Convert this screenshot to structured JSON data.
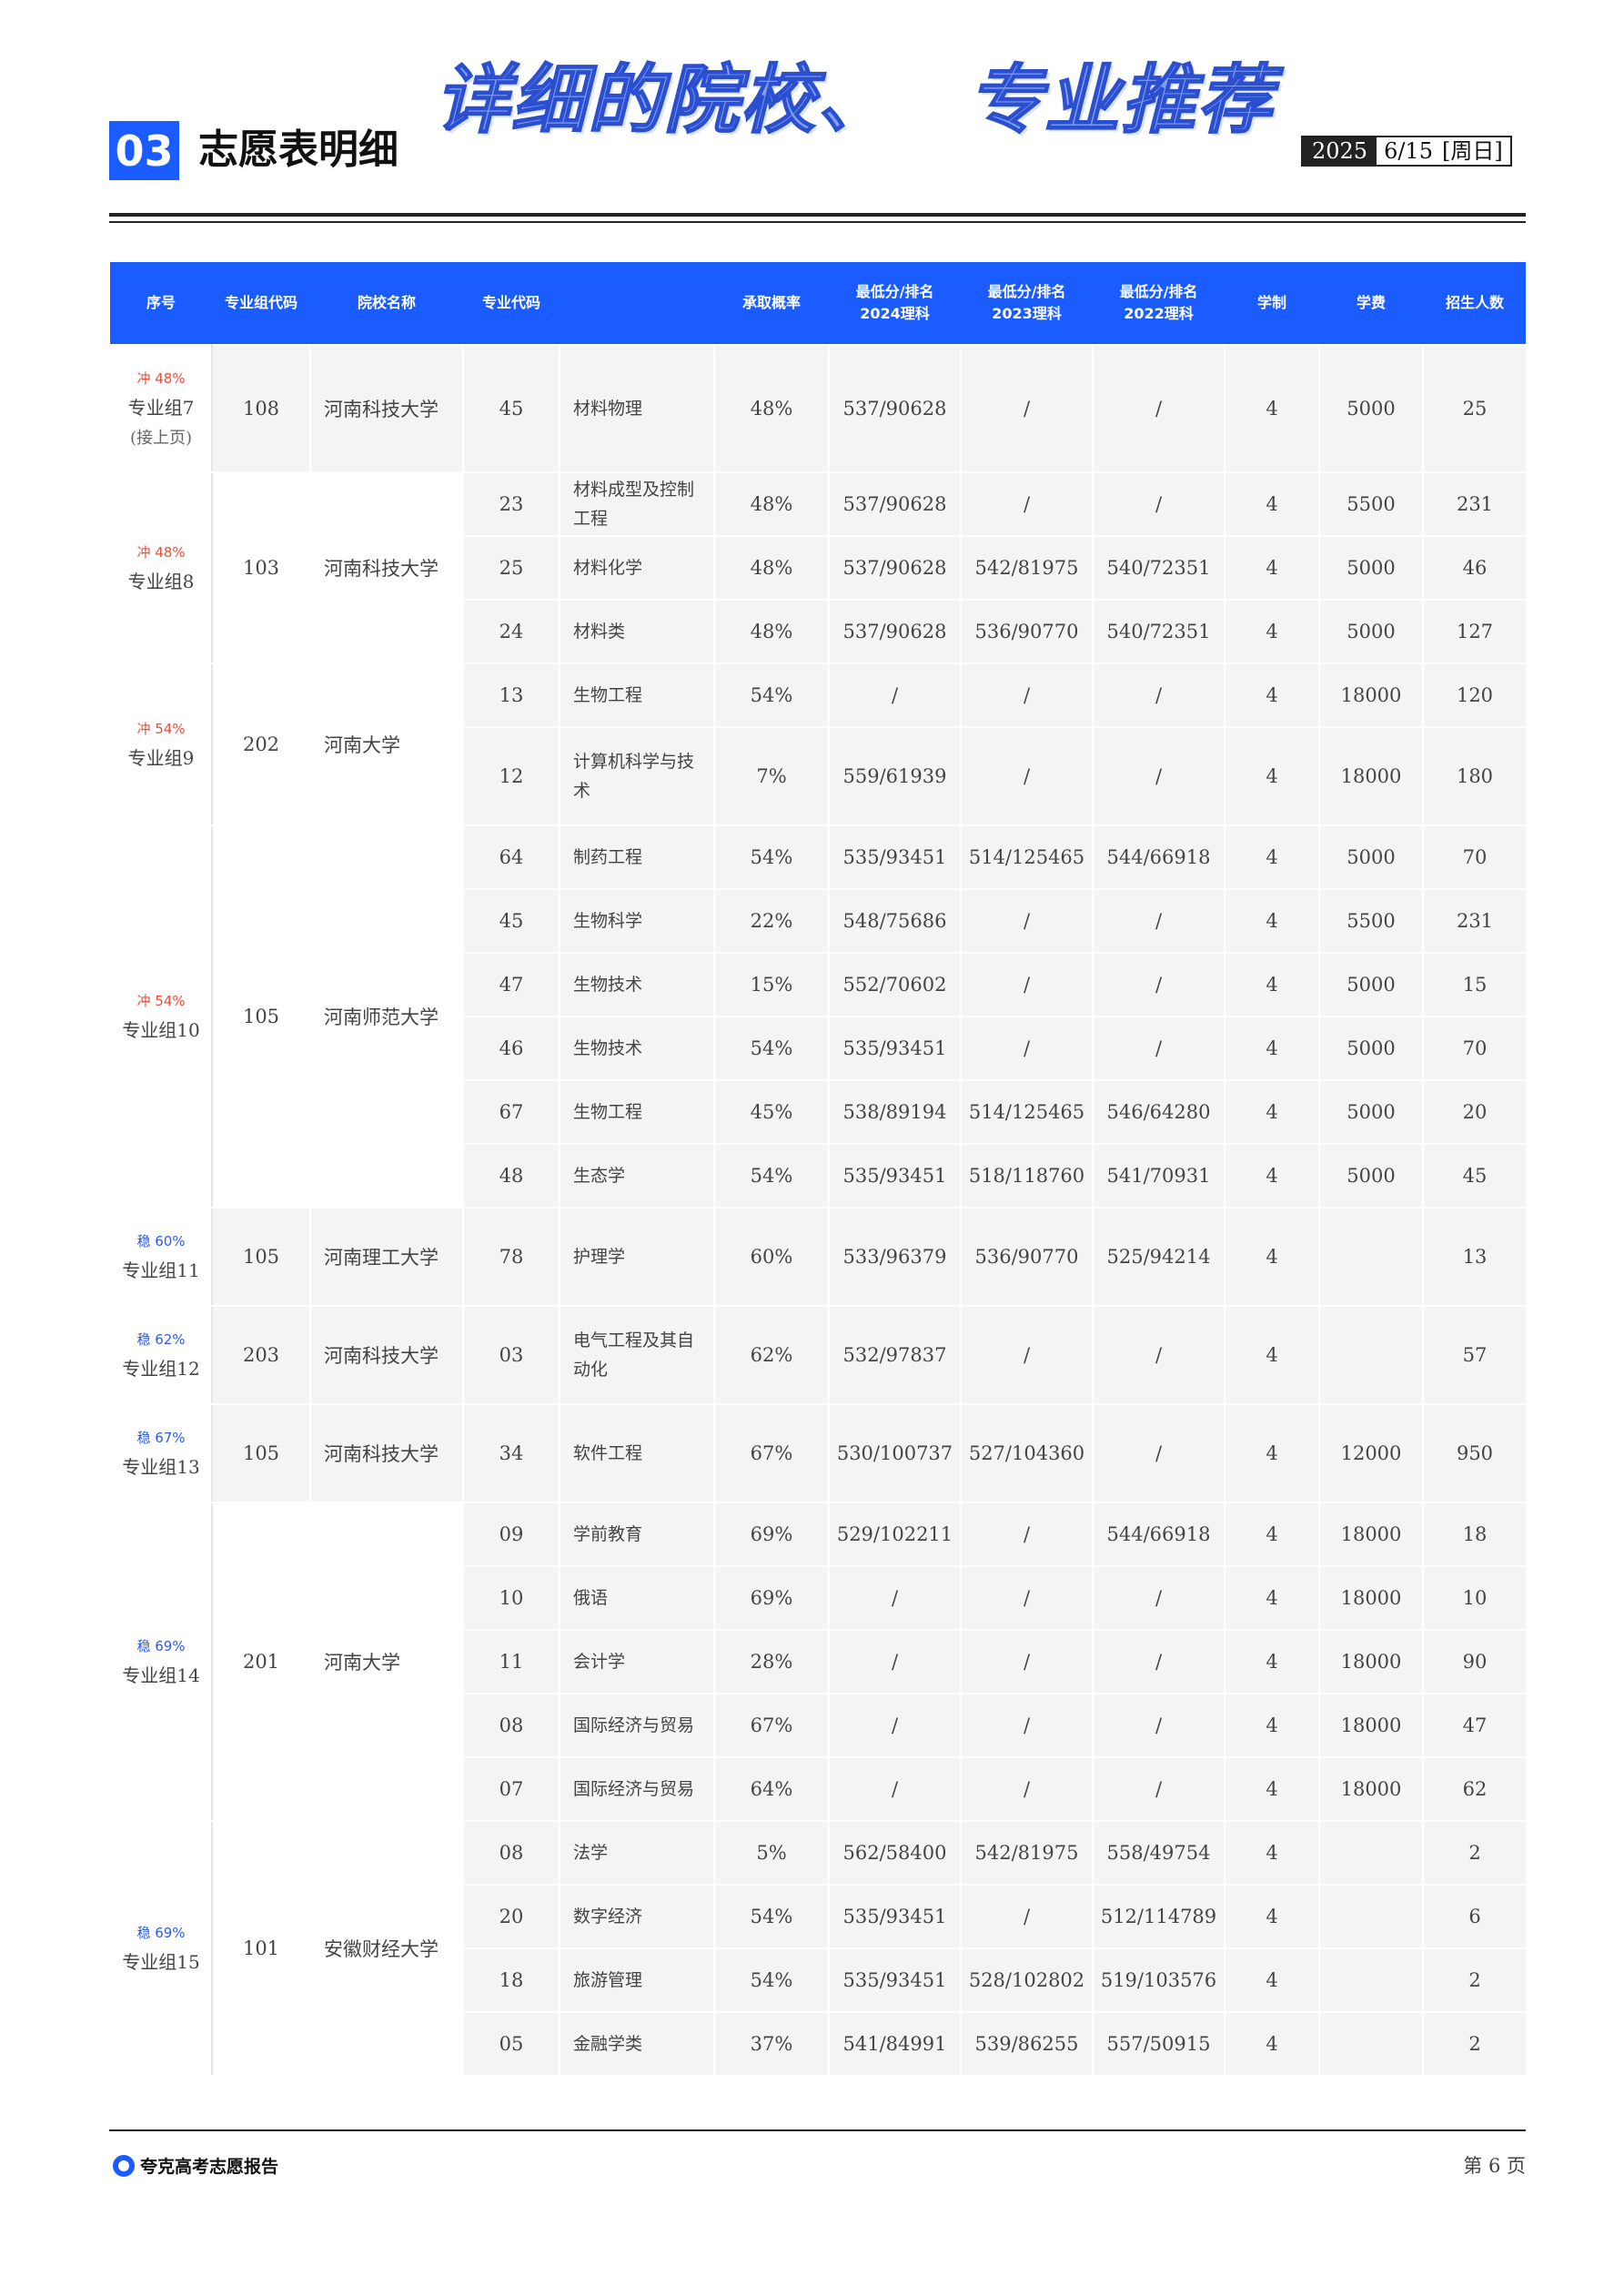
{
  "header": {
    "banner_left": "详细的院校、",
    "banner_right": "专业推荐",
    "section_number": "03",
    "section_title": "志愿表明细",
    "date_year": "2025",
    "date_day": "6/15",
    "date_weekday": "[周日]"
  },
  "table": {
    "headers": {
      "seq": "序号",
      "group_code": "专业组代码",
      "school": "院校名称",
      "major_code": "专业代码",
      "major": "",
      "prob": "承取概率",
      "s2024_line1": "最低分/排名",
      "s2024_line2": "2024理科",
      "s2023_line1": "最低分/排名",
      "s2023_line2": "2023理科",
      "s2022_line1": "最低分/排名",
      "s2022_line2": "2022理科",
      "years": "学制",
      "fee": "学费",
      "quota": "招生人数"
    },
    "groups": [
      {
        "tag": "冲 48%",
        "tag_color": "red",
        "group": "专业组7",
        "note": "(接上页)",
        "code": "108",
        "school": "河南科技大学",
        "rows": [
          {
            "code": "45",
            "major": "材料物理",
            "prob": "48%",
            "s2024": "537/90628",
            "s2023": "/",
            "s2022": "/",
            "years": "4",
            "fee": "5000",
            "quota": "25"
          }
        ]
      },
      {
        "tag": "冲 48%",
        "tag_color": "red",
        "group": "专业组8",
        "note": "",
        "code": "103",
        "school": "河南科技大学",
        "rows": [
          {
            "code": "23",
            "major": "材料成型及控制工程",
            "prob": "48%",
            "s2024": "537/90628",
            "s2023": "/",
            "s2022": "/",
            "years": "4",
            "fee": "5500",
            "quota": "231"
          },
          {
            "code": "25",
            "major": "材料化学",
            "prob": "48%",
            "s2024": "537/90628",
            "s2023": "542/81975",
            "s2022": "540/72351",
            "years": "4",
            "fee": "5000",
            "quota": "46"
          },
          {
            "code": "24",
            "major": "材料类",
            "prob": "48%",
            "s2024": "537/90628",
            "s2023": "536/90770",
            "s2022": "540/72351",
            "years": "4",
            "fee": "5000",
            "quota": "127"
          }
        ]
      },
      {
        "tag": "冲 54%",
        "tag_color": "red",
        "group": "专业组9",
        "note": "",
        "code": "202",
        "school": "河南大学",
        "rows": [
          {
            "code": "13",
            "major": "生物工程",
            "prob": "54%",
            "s2024": "/",
            "s2023": "/",
            "s2022": "/",
            "years": "4",
            "fee": "18000",
            "quota": "120"
          },
          {
            "code": "12",
            "major": "计算机科学与技术",
            "prob": "7%",
            "s2024": "559/61939",
            "s2023": "/",
            "s2022": "/",
            "years": "4",
            "fee": "18000",
            "quota": "180"
          }
        ]
      },
      {
        "tag": "冲 54%",
        "tag_color": "red",
        "group": "专业组10",
        "note": "",
        "code": "105",
        "school": "河南师范大学",
        "rows": [
          {
            "code": "64",
            "major": "制药工程",
            "prob": "54%",
            "s2024": "535/93451",
            "s2023": "514/125465",
            "s2022": "544/66918",
            "years": "4",
            "fee": "5000",
            "quota": "70"
          },
          {
            "code": "45",
            "major": "生物科学",
            "prob": "22%",
            "s2024": "548/75686",
            "s2023": "/",
            "s2022": "/",
            "years": "4",
            "fee": "5500",
            "quota": "231"
          },
          {
            "code": "47",
            "major": "生物技术",
            "prob": "15%",
            "s2024": "552/70602",
            "s2023": "/",
            "s2022": "/",
            "years": "4",
            "fee": "5000",
            "quota": "15"
          },
          {
            "code": "46",
            "major": "生物技术",
            "prob": "54%",
            "s2024": "535/93451",
            "s2023": "/",
            "s2022": "/",
            "years": "4",
            "fee": "5000",
            "quota": "70"
          },
          {
            "code": "67",
            "major": "生物工程",
            "prob": "45%",
            "s2024": "538/89194",
            "s2023": "514/125465",
            "s2022": "546/64280",
            "years": "4",
            "fee": "5000",
            "quota": "20"
          },
          {
            "code": "48",
            "major": "生态学",
            "prob": "54%",
            "s2024": "535/93451",
            "s2023": "518/118760",
            "s2022": "541/70931",
            "years": "4",
            "fee": "5000",
            "quota": "45"
          }
        ]
      },
      {
        "tag": "稳 60%",
        "tag_color": "blue",
        "group": "专业组11",
        "note": "",
        "code": "105",
        "school": "河南理工大学",
        "rows": [
          {
            "code": "78",
            "major": "护理学",
            "prob": "60%",
            "s2024": "533/96379",
            "s2023": "536/90770",
            "s2022": "525/94214",
            "years": "4",
            "fee": "",
            "quota": "13"
          }
        ]
      },
      {
        "tag": "稳 62%",
        "tag_color": "blue",
        "group": "专业组12",
        "note": "",
        "code": "203",
        "school": "河南科技大学",
        "rows": [
          {
            "code": "03",
            "major": "电气工程及其自动化",
            "prob": "62%",
            "s2024": "532/97837",
            "s2023": "/",
            "s2022": "/",
            "years": "4",
            "fee": "",
            "quota": "57"
          }
        ]
      },
      {
        "tag": "稳 67%",
        "tag_color": "blue",
        "group": "专业组13",
        "note": "",
        "code": "105",
        "school": "河南科技大学",
        "rows": [
          {
            "code": "34",
            "major": "软件工程",
            "prob": "67%",
            "s2024": "530/100737",
            "s2023": "527/104360",
            "s2022": "/",
            "years": "4",
            "fee": "12000",
            "quota": "950"
          }
        ]
      },
      {
        "tag": "稳 69%",
        "tag_color": "blue",
        "group": "专业组14",
        "note": "",
        "code": "201",
        "school": "河南大学",
        "rows": [
          {
            "code": "09",
            "major": "学前教育",
            "prob": "69%",
            "s2024": "529/102211",
            "s2023": "/",
            "s2022": "544/66918",
            "years": "4",
            "fee": "18000",
            "quota": "18"
          },
          {
            "code": "10",
            "major": "俄语",
            "prob": "69%",
            "s2024": "/",
            "s2023": "/",
            "s2022": "/",
            "years": "4",
            "fee": "18000",
            "quota": "10"
          },
          {
            "code": "11",
            "major": "会计学",
            "prob": "28%",
            "s2024": "/",
            "s2023": "/",
            "s2022": "/",
            "years": "4",
            "fee": "18000",
            "quota": "90"
          },
          {
            "code": "08",
            "major": "国际经济与贸易",
            "prob": "67%",
            "s2024": "/",
            "s2023": "/",
            "s2022": "/",
            "years": "4",
            "fee": "18000",
            "quota": "47"
          },
          {
            "code": "07",
            "major": "国际经济与贸易",
            "prob": "64%",
            "s2024": "/",
            "s2023": "/",
            "s2022": "/",
            "years": "4",
            "fee": "18000",
            "quota": "62"
          }
        ]
      },
      {
        "tag": "稳 69%",
        "tag_color": "blue",
        "group": "专业组15",
        "note": "",
        "code": "101",
        "school": "安徽财经大学",
        "rows": [
          {
            "code": "08",
            "major": "法学",
            "prob": "5%",
            "s2024": "562/58400",
            "s2023": "542/81975",
            "s2022": "558/49754",
            "years": "4",
            "fee": "",
            "quota": "2"
          },
          {
            "code": "20",
            "major": "数字经济",
            "prob": "54%",
            "s2024": "535/93451",
            "s2023": "/",
            "s2022": "512/114789",
            "years": "4",
            "fee": "",
            "quota": "6"
          },
          {
            "code": "18",
            "major": "旅游管理",
            "prob": "54%",
            "s2024": "535/93451",
            "s2023": "528/102802",
            "s2022": "519/103576",
            "years": "4",
            "fee": "",
            "quota": "2"
          },
          {
            "code": "05",
            "major": "金融学类",
            "prob": "37%",
            "s2024": "541/84991",
            "s2023": "539/86255",
            "s2022": "557/50915",
            "years": "4",
            "fee": "",
            "quota": "2"
          }
        ]
      }
    ]
  },
  "footer": {
    "brand": "夸克高考志愿报告",
    "page": "第 6 页"
  }
}
